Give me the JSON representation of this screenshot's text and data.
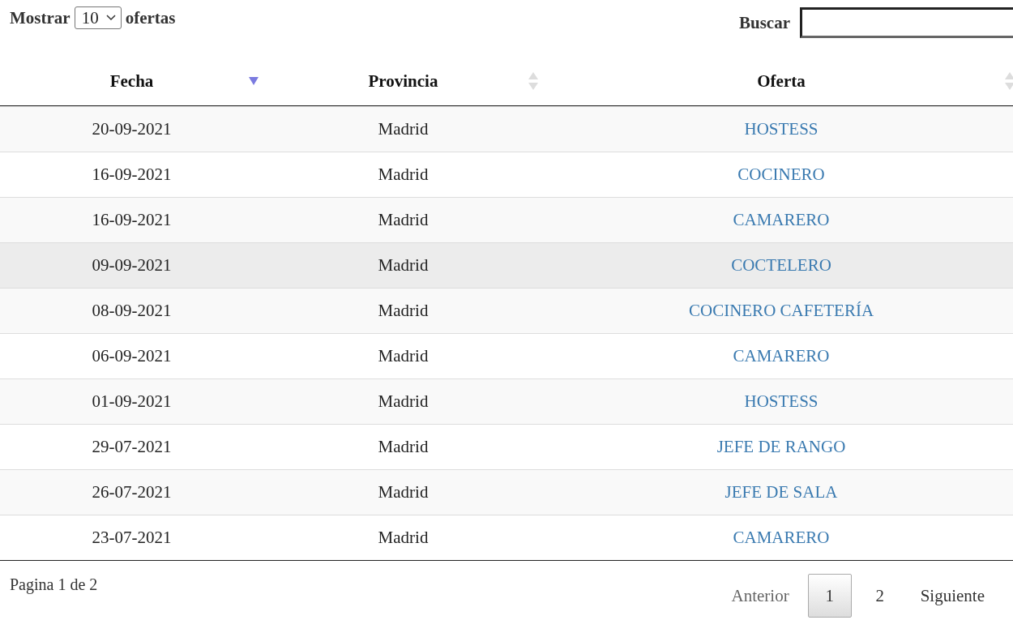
{
  "length_control": {
    "label_before": "Mostrar",
    "value": "10",
    "label_after": "ofertas"
  },
  "search": {
    "label": "Buscar"
  },
  "table": {
    "columns": [
      {
        "label": "Fecha",
        "sorted": true
      },
      {
        "label": "Provincia",
        "sorted": false
      },
      {
        "label": "Oferta",
        "sorted": false
      }
    ],
    "rows": [
      {
        "date": "20-09-2021",
        "province": "Madrid",
        "offer": "HOSTESS",
        "hovered": false
      },
      {
        "date": "16-09-2021",
        "province": "Madrid",
        "offer": "COCINERO",
        "hovered": false
      },
      {
        "date": "16-09-2021",
        "province": "Madrid",
        "offer": "CAMARERO",
        "hovered": false
      },
      {
        "date": "09-09-2021",
        "province": "Madrid",
        "offer": "COCTELERO",
        "hovered": true
      },
      {
        "date": "08-09-2021",
        "province": "Madrid",
        "offer": "COCINERO CAFETERÍA",
        "hovered": false
      },
      {
        "date": "06-09-2021",
        "province": "Madrid",
        "offer": "CAMARERO",
        "hovered": false
      },
      {
        "date": "01-09-2021",
        "province": "Madrid",
        "offer": "HOSTESS",
        "hovered": false
      },
      {
        "date": "29-07-2021",
        "province": "Madrid",
        "offer": "JEFE DE RANGO",
        "hovered": false
      },
      {
        "date": "26-07-2021",
        "province": "Madrid",
        "offer": "JEFE DE SALA",
        "hovered": false
      },
      {
        "date": "23-07-2021",
        "province": "Madrid",
        "offer": "CAMARERO",
        "hovered": false
      }
    ]
  },
  "info": "Pagina 1 de 2",
  "pagination": {
    "previous": {
      "label": "Anterior",
      "disabled": true
    },
    "pages": [
      {
        "label": "1",
        "selected": true
      },
      {
        "label": "2",
        "selected": false
      }
    ],
    "next": {
      "label": "Siguiente",
      "disabled": false
    }
  }
}
